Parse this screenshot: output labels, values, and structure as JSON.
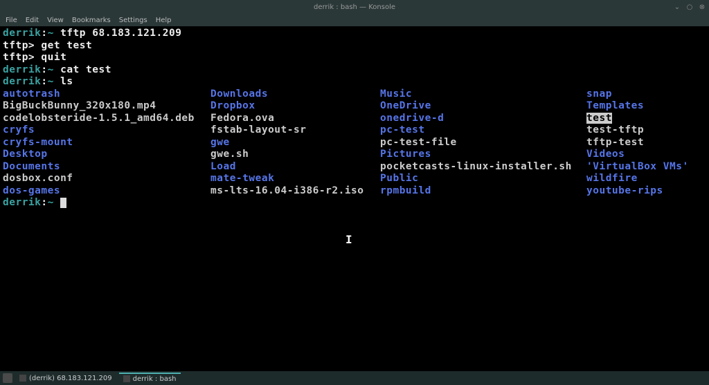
{
  "window": {
    "title": "derrik : bash — Konsole"
  },
  "menu": {
    "file": "File",
    "edit": "Edit",
    "view": "View",
    "bookmarks": "Bookmarks",
    "settings": "Settings",
    "help": "Help"
  },
  "terminal": {
    "prompt_user": "derrik",
    "prompt_sep": ":",
    "prompt_path": "~",
    "cmd1": "tftp 68.183.121.209",
    "tftp_prompt": "tftp>",
    "tftp_cmd1": "get test",
    "tftp_cmd2": "quit",
    "cmd2": "cat test",
    "cmd3": "ls",
    "ls": {
      "col1": [
        {
          "name": "autotrash",
          "type": "dir"
        },
        {
          "name": "BigBuckBunny_320x180.mp4",
          "type": "file"
        },
        {
          "name": "codelobsteride-1.5.1_amd64.deb",
          "type": "file"
        },
        {
          "name": "cryfs",
          "type": "dir"
        },
        {
          "name": "cryfs-mount",
          "type": "dir"
        },
        {
          "name": "Desktop",
          "type": "dir"
        },
        {
          "name": "Documents",
          "type": "dir"
        },
        {
          "name": "dosbox.conf",
          "type": "file"
        },
        {
          "name": "dos-games",
          "type": "dir"
        }
      ],
      "col2": [
        {
          "name": "Downloads",
          "type": "dir"
        },
        {
          "name": "Dropbox",
          "type": "dir"
        },
        {
          "name": "Fedora.ova",
          "type": "file"
        },
        {
          "name": "fstab-layout-sr",
          "type": "file"
        },
        {
          "name": "gwe",
          "type": "dir"
        },
        {
          "name": "gwe.sh",
          "type": "file"
        },
        {
          "name": "Load",
          "type": "dir"
        },
        {
          "name": "mate-tweak",
          "type": "dir"
        },
        {
          "name": "ms-lts-16.04-i386-r2.iso",
          "type": "file"
        }
      ],
      "col3": [
        {
          "name": "Music",
          "type": "dir"
        },
        {
          "name": "OneDrive",
          "type": "dir"
        },
        {
          "name": "onedrive-d",
          "type": "dir"
        },
        {
          "name": "pc-test",
          "type": "dir"
        },
        {
          "name": "pc-test-file",
          "type": "file"
        },
        {
          "name": "Pictures",
          "type": "dir"
        },
        {
          "name": "pocketcasts-linux-installer.sh",
          "type": "file"
        },
        {
          "name": "Public",
          "type": "dir"
        },
        {
          "name": "rpmbuild",
          "type": "dir"
        }
      ],
      "col4": [
        {
          "name": "snap",
          "type": "dir"
        },
        {
          "name": "Templates",
          "type": "dir"
        },
        {
          "name": "test",
          "type": "highlight"
        },
        {
          "name": "test-tftp",
          "type": "file"
        },
        {
          "name": "tftp-test",
          "type": "file"
        },
        {
          "name": "Videos",
          "type": "dir"
        },
        {
          "name": "'VirtualBox VMs'",
          "type": "dir"
        },
        {
          "name": "wildfire",
          "type": "dir"
        },
        {
          "name": "youtube-rips",
          "type": "dir"
        }
      ]
    }
  },
  "taskbar": {
    "item1": "(derrik) 68.183.121.209",
    "item2": "derrik : bash"
  }
}
